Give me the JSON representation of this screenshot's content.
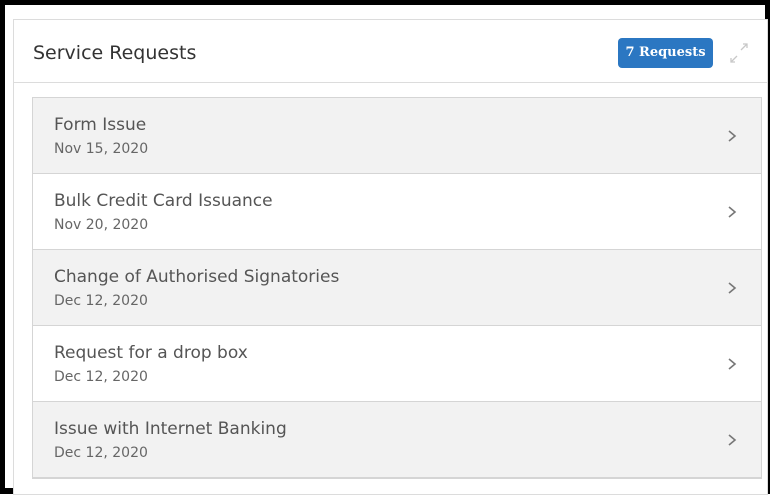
{
  "widget": {
    "title": "Service Requests",
    "badge_label": "7 Requests"
  },
  "icons": {
    "expand": "expand-icon",
    "chevron": "chevron-right-icon"
  },
  "colors": {
    "badge_bg": "#2b77c2",
    "row_shade": "#f2f2f2"
  },
  "requests": [
    {
      "title": "Form Issue",
      "date": "Nov 15, 2020"
    },
    {
      "title": "Bulk Credit Card Issuance",
      "date": "Nov 20, 2020"
    },
    {
      "title": "Change of Authorised Signatories",
      "date": "Dec 12, 2020"
    },
    {
      "title": "Request for a drop box",
      "date": "Dec 12, 2020"
    },
    {
      "title": "Issue with Internet Banking",
      "date": "Dec 12, 2020"
    }
  ]
}
